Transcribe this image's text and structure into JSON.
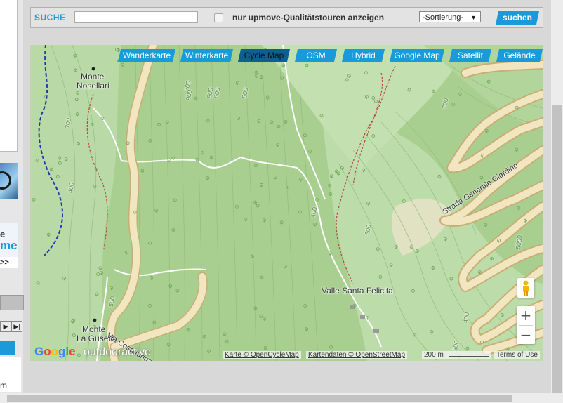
{
  "search": {
    "label": "SUCHE",
    "input_value": "",
    "checkbox_label": "nur upmove-Qualitätstouren anzeigen",
    "checkbox_checked": false,
    "sort_selected": "-Sortierung-",
    "button": "suchen"
  },
  "map": {
    "tabs": [
      "Wanderkarte",
      "Winterkarte",
      "Cycle Map",
      "OSM",
      "Hybrid",
      "Google Map",
      "Satellit",
      "Gelände"
    ],
    "active_tab": "Cycle Map",
    "labels": {
      "monte_nosellari_1": "Monte",
      "monte_nosellari_2": "Nosellari",
      "monte_gusella_1": "Monte",
      "monte_gusella_2": "La Gusella",
      "via_costalunga": "Via Costalunga",
      "valle_santa_felicita": "Valle Santa Felicita",
      "strada_generale_giardino": "Strada Generale Giardino"
    },
    "contours": [
      "700",
      "900",
      "800",
      "600",
      "500",
      "800",
      "700",
      "400",
      "500",
      "600",
      "500",
      "400",
      "300",
      "500",
      "400",
      "700",
      "800"
    ],
    "zoom_in": "+",
    "zoom_out": "−",
    "scale": "200 m",
    "attribution_map": "Karte © OpenCycleMap",
    "attribution_data": "Kartendaten © OpenStreetMap",
    "terms": "Terms of Use",
    "brand_google": "Google",
    "brand_outdoor": "outdooractive"
  },
  "left_column": {
    "promo_e": "e",
    "promo_me": "me",
    "arrows": ">>",
    "snippet_m": "m"
  },
  "colors": {
    "accent": "#1a9ad8",
    "map_green": "#a7cf8e",
    "road_fill": "#f1e6c0",
    "road_edge": "#c8ad74",
    "trail": "#b5473a",
    "border": "#1f3ca8"
  }
}
